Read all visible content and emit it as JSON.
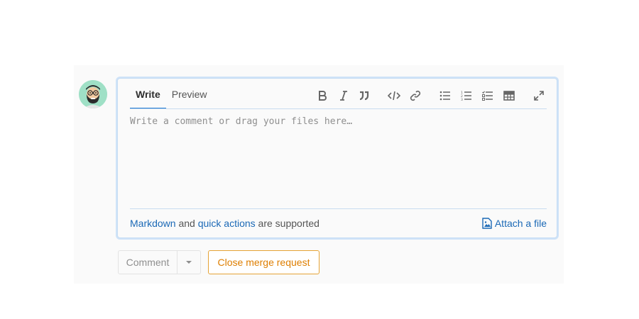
{
  "avatar": {
    "alt": "User avatar",
    "bg_color": "#9fe0c6"
  },
  "editor": {
    "tabs": [
      {
        "label": "Write",
        "active": true
      },
      {
        "label": "Preview",
        "active": false
      }
    ],
    "toolbar": [
      {
        "name": "bold-icon",
        "glyph": "B"
      },
      {
        "name": "italic-icon",
        "glyph": "I"
      },
      {
        "name": "quote-icon",
        "glyph": "❞"
      },
      {
        "name": "code-icon",
        "glyph": "</>"
      },
      {
        "name": "link-icon",
        "glyph": "link"
      },
      {
        "name": "bullet-list-icon",
        "glyph": "list"
      },
      {
        "name": "numbered-list-icon",
        "glyph": "olist"
      },
      {
        "name": "task-list-icon",
        "glyph": "tasks"
      },
      {
        "name": "table-icon",
        "glyph": "table"
      },
      {
        "name": "fullscreen-icon",
        "glyph": "expand"
      }
    ],
    "textarea": {
      "placeholder": "Write a comment or drag your files here…",
      "value": ""
    },
    "footer": {
      "markdown_link": "Markdown",
      "and_text": " and ",
      "quick_actions_link": "quick actions",
      "supported_text": " are supported",
      "attach_label": "Attach a file"
    },
    "accent_color": "#1f78d1"
  },
  "actions": {
    "comment_label": "Comment",
    "close_label": "Close merge request",
    "close_color": "#de7e00"
  }
}
